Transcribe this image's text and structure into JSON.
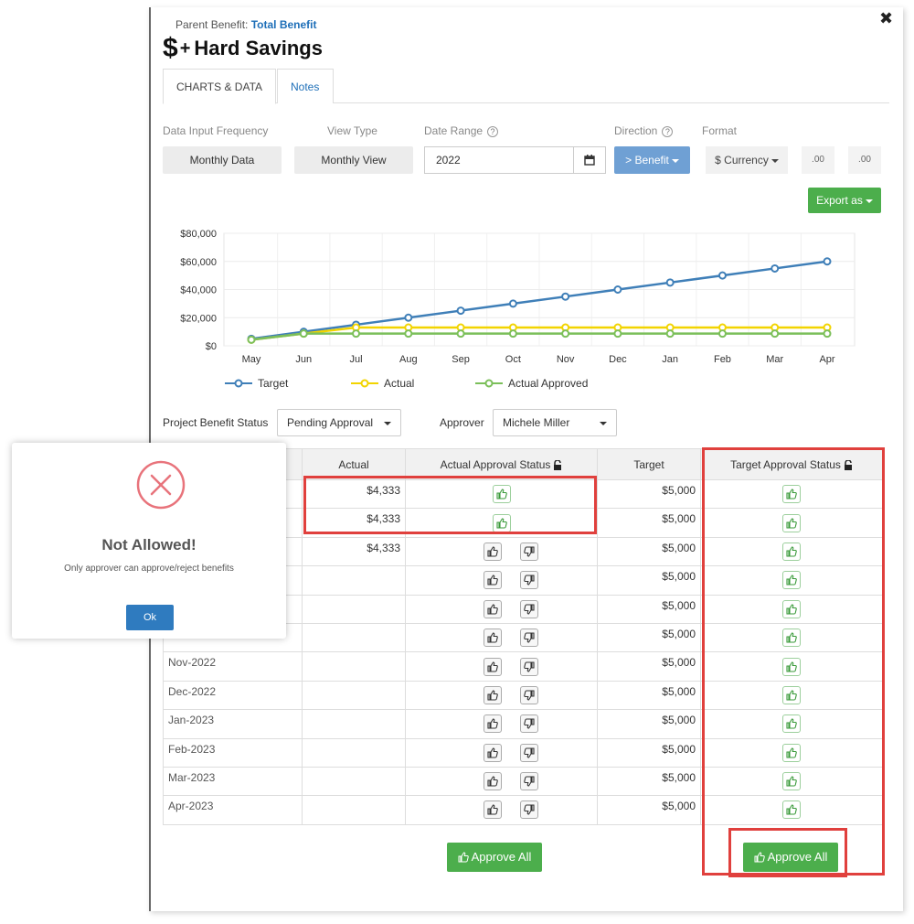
{
  "modal": {
    "parent_label": "Parent Benefit:",
    "parent_value": "Total Benefit",
    "title": "Hard Savings",
    "tabs": [
      "CHARTS & DATA",
      "Notes"
    ]
  },
  "controls": {
    "frequency_label": "Data Input Frequency",
    "frequency_value": "Monthly Data",
    "view_label": "View Type",
    "view_value": "Monthly View",
    "date_label": "Date Range",
    "date_value": "2022",
    "direction_label": "Direction",
    "direction_value": "> Benefit",
    "format_label": "Format",
    "format_value": "$ Currency",
    "decimal_left": ".00",
    "decimal_right": ".00",
    "export_label": "Export as"
  },
  "chart_data": {
    "type": "line",
    "categories": [
      "May",
      "Jun",
      "Jul",
      "Aug",
      "Sep",
      "Oct",
      "Nov",
      "Dec",
      "Jan",
      "Feb",
      "Mar",
      "Apr"
    ],
    "y_ticks": [
      "$80,000",
      "$60,000",
      "$40,000",
      "$20,000",
      "$0"
    ],
    "ylim": [
      0,
      80000
    ],
    "grid": true,
    "legend_position": "bottom",
    "series": [
      {
        "name": "Target",
        "color": "#3f7fb8",
        "values": [
          5000,
          10000,
          15000,
          20000,
          25000,
          30000,
          35000,
          40000,
          45000,
          50000,
          55000,
          60000
        ]
      },
      {
        "name": "Actual",
        "color": "#f2d400",
        "values": [
          4333,
          8666,
          13000,
          13000,
          13000,
          13000,
          13000,
          13000,
          13000,
          13000,
          13000,
          13000
        ]
      },
      {
        "name": "Actual Approved",
        "color": "#7bbf5a",
        "values": [
          4333,
          8666,
          8666,
          8666,
          8666,
          8666,
          8666,
          8666,
          8666,
          8666,
          8666,
          8666
        ]
      }
    ]
  },
  "status": {
    "label": "Project Benefit Status",
    "value": "Pending Approval",
    "approver_label": "Approver",
    "approver_value": "Michele Miller"
  },
  "table": {
    "headers": [
      "",
      "Actual",
      "Actual Approval Status",
      "Target",
      "Target Approval Status"
    ],
    "rows": [
      {
        "month": "",
        "actual": "$4,333",
        "actual_state": "approved",
        "target": "$5,000"
      },
      {
        "month": "",
        "actual": "$4,333",
        "actual_state": "approved",
        "target": "$5,000"
      },
      {
        "month": "",
        "actual": "$4,333",
        "actual_state": "pending",
        "target": "$5,000"
      },
      {
        "month": "",
        "actual": "",
        "actual_state": "pending",
        "target": "$5,000"
      },
      {
        "month": "",
        "actual": "",
        "actual_state": "pending",
        "target": "$5,000"
      },
      {
        "month": "",
        "actual": "",
        "actual_state": "pending",
        "target": "$5,000"
      },
      {
        "month": "Nov-2022",
        "actual": "",
        "actual_state": "pending",
        "target": "$5,000"
      },
      {
        "month": "Dec-2022",
        "actual": "",
        "actual_state": "pending",
        "target": "$5,000"
      },
      {
        "month": "Jan-2023",
        "actual": "",
        "actual_state": "pending",
        "target": "$5,000"
      },
      {
        "month": "Feb-2023",
        "actual": "",
        "actual_state": "pending",
        "target": "$5,000"
      },
      {
        "month": "Mar-2023",
        "actual": "",
        "actual_state": "pending",
        "target": "$5,000"
      },
      {
        "month": "Apr-2023",
        "actual": "",
        "actual_state": "pending",
        "target": "$5,000"
      }
    ],
    "approve_all_label": "Approve All"
  },
  "dialog": {
    "title": "Not Allowed!",
    "message": "Only approver can approve/reject benefits",
    "ok_label": "Ok"
  },
  "colors": {
    "accent_green": "#4cae4c",
    "direction_blue": "#6fa0d4",
    "highlight_red": "#e0403d",
    "link_blue": "#1e6fb8"
  }
}
